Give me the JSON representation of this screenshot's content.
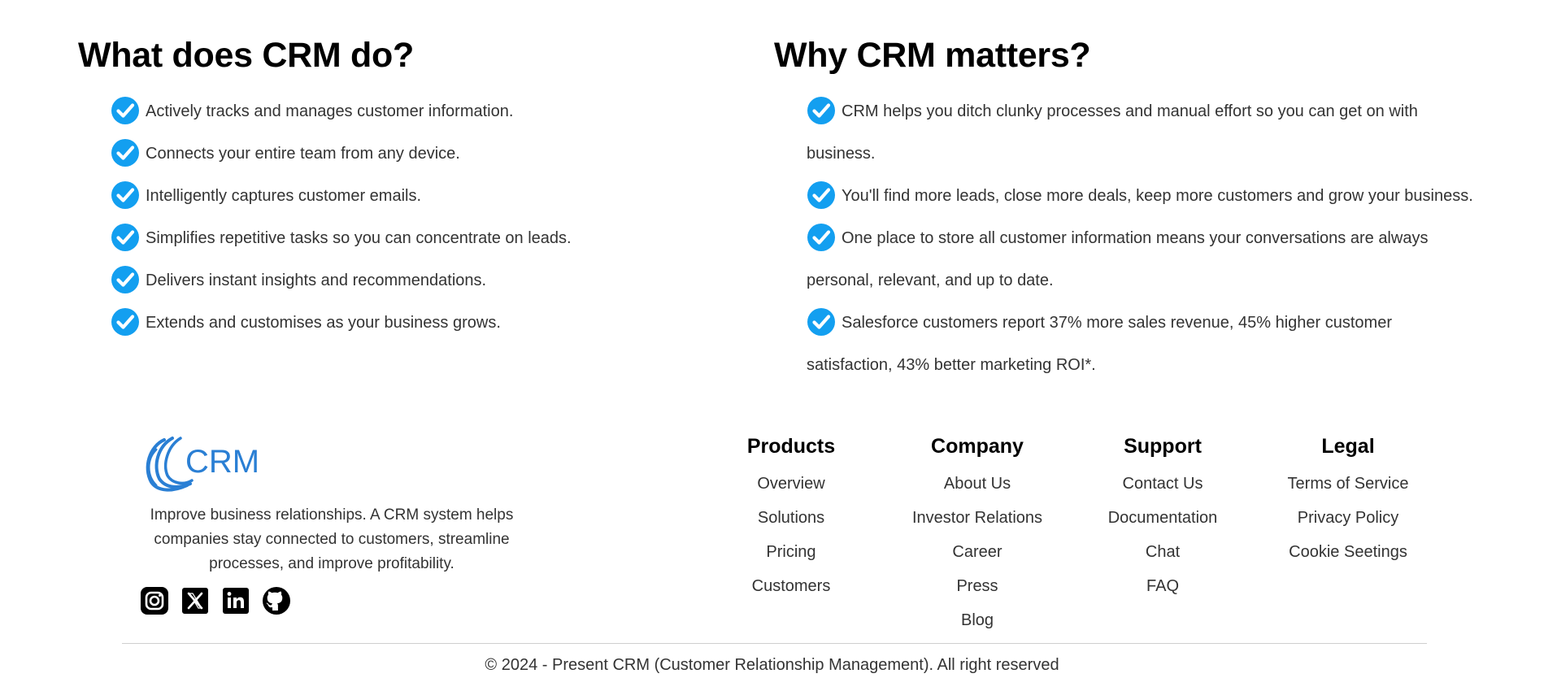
{
  "what_section": {
    "title": "What does CRM do?",
    "items": [
      "Actively tracks and manages customer information.",
      "Connects your entire team from any device.",
      "Intelligently captures customer emails.",
      "Simplifies repetitive tasks so you can concentrate on leads.",
      "Delivers instant insights and recommendations.",
      "Extends and customises as your business grows."
    ]
  },
  "why_section": {
    "title": "Why CRM matters?",
    "items": [
      "CRM helps you ditch clunky processes and manual effort so you can get on with business.",
      "You'll find more leads, close more deals, keep more customers and grow your business.",
      "One place to store all customer information means your conversations are always personal, relevant, and up to date.",
      "Salesforce customers report 37% more sales revenue, 45% higher customer satisfaction, 43% better marketing ROI*."
    ]
  },
  "footer": {
    "logo_text": "CRM",
    "tagline": "Improve business relationships. A CRM system helps companies stay connected to customers, streamline processes, and improve profitability.",
    "socials": [
      "instagram-icon",
      "x-icon",
      "linkedin-icon",
      "github-icon"
    ],
    "columns": {
      "products": {
        "title": "Products",
        "links": [
          "Overview",
          "Solutions",
          "Pricing",
          "Customers"
        ]
      },
      "company": {
        "title": "Company",
        "links": [
          "About Us",
          "Investor Relations",
          "Career",
          "Press",
          "Blog"
        ]
      },
      "support": {
        "title": "Support",
        "links": [
          "Contact Us",
          "Documentation",
          "Chat",
          "FAQ"
        ]
      },
      "legal": {
        "title": "Legal",
        "links": [
          "Terms of Service",
          "Privacy Policy",
          "Cookie Seetings"
        ]
      }
    },
    "copyright": "© 2024 - Present CRM (Customer Relationship Management). All right reserved"
  },
  "colors": {
    "check_blue": "#1da1f2",
    "logo_blue": "#2a7fd4"
  }
}
